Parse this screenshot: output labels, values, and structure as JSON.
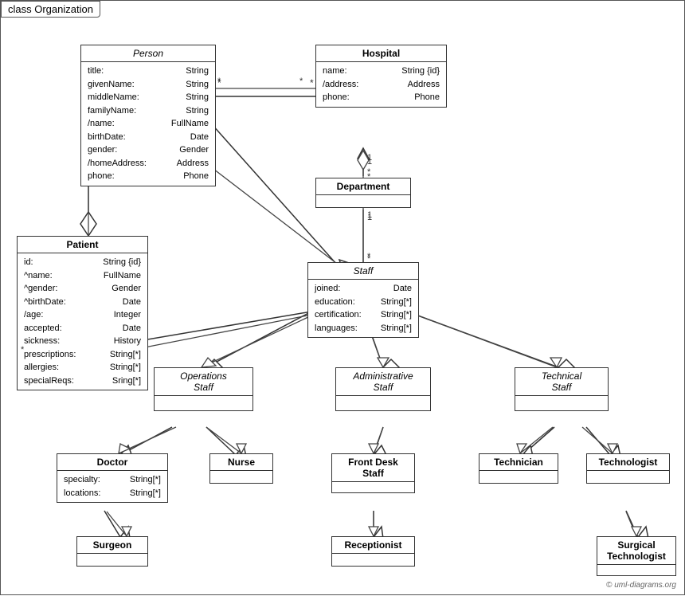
{
  "diagram": {
    "title": "class Organization",
    "copyright": "© uml-diagrams.org",
    "classes": {
      "person": {
        "name": "Person",
        "italic": true,
        "attrs": [
          {
            "name": "title:",
            "type": "String"
          },
          {
            "name": "givenName:",
            "type": "String"
          },
          {
            "name": "middleName:",
            "type": "String"
          },
          {
            "name": "familyName:",
            "type": "String"
          },
          {
            "name": "/name:",
            "type": "FullName"
          },
          {
            "name": "birthDate:",
            "type": "Date"
          },
          {
            "name": "gender:",
            "type": "Gender"
          },
          {
            "name": "/homeAddress:",
            "type": "Address"
          },
          {
            "name": "phone:",
            "type": "Phone"
          }
        ]
      },
      "hospital": {
        "name": "Hospital",
        "italic": false,
        "attrs": [
          {
            "name": "name:",
            "type": "String {id}"
          },
          {
            "name": "/address:",
            "type": "Address"
          },
          {
            "name": "phone:",
            "type": "Phone"
          }
        ]
      },
      "patient": {
        "name": "Patient",
        "italic": false,
        "attrs": [
          {
            "name": "id:",
            "type": "String {id}"
          },
          {
            "name": "^name:",
            "type": "FullName"
          },
          {
            "name": "^gender:",
            "type": "Gender"
          },
          {
            "name": "^birthDate:",
            "type": "Date"
          },
          {
            "name": "/age:",
            "type": "Integer"
          },
          {
            "name": "accepted:",
            "type": "Date"
          },
          {
            "name": "sickness:",
            "type": "History"
          },
          {
            "name": "prescriptions:",
            "type": "String[*]"
          },
          {
            "name": "allergies:",
            "type": "String[*]"
          },
          {
            "name": "specialReqs:",
            "type": "Sring[*]"
          }
        ]
      },
      "department": {
        "name": "Department",
        "italic": false,
        "attrs": []
      },
      "staff": {
        "name": "Staff",
        "italic": true,
        "attrs": [
          {
            "name": "joined:",
            "type": "Date"
          },
          {
            "name": "education:",
            "type": "String[*]"
          },
          {
            "name": "certification:",
            "type": "String[*]"
          },
          {
            "name": "languages:",
            "type": "String[*]"
          }
        ]
      },
      "ops_staff": {
        "name": "Operations\nStaff",
        "italic": true
      },
      "admin_staff": {
        "name": "Administrative\nStaff",
        "italic": true
      },
      "tech_staff": {
        "name": "Technical\nStaff",
        "italic": true
      },
      "doctor": {
        "name": "Doctor",
        "italic": false,
        "attrs": [
          {
            "name": "specialty:",
            "type": "String[*]"
          },
          {
            "name": "locations:",
            "type": "String[*]"
          }
        ]
      },
      "nurse": {
        "name": "Nurse",
        "italic": false,
        "attrs": []
      },
      "front_desk": {
        "name": "Front Desk\nStaff",
        "italic": false,
        "attrs": []
      },
      "technician": {
        "name": "Technician",
        "italic": false,
        "attrs": []
      },
      "technologist": {
        "name": "Technologist",
        "italic": false,
        "attrs": []
      },
      "surgeon": {
        "name": "Surgeon",
        "italic": false,
        "attrs": []
      },
      "receptionist": {
        "name": "Receptionist",
        "italic": false,
        "attrs": []
      },
      "surgical_tech": {
        "name": "Surgical\nTechnologist",
        "italic": false,
        "attrs": []
      }
    }
  }
}
